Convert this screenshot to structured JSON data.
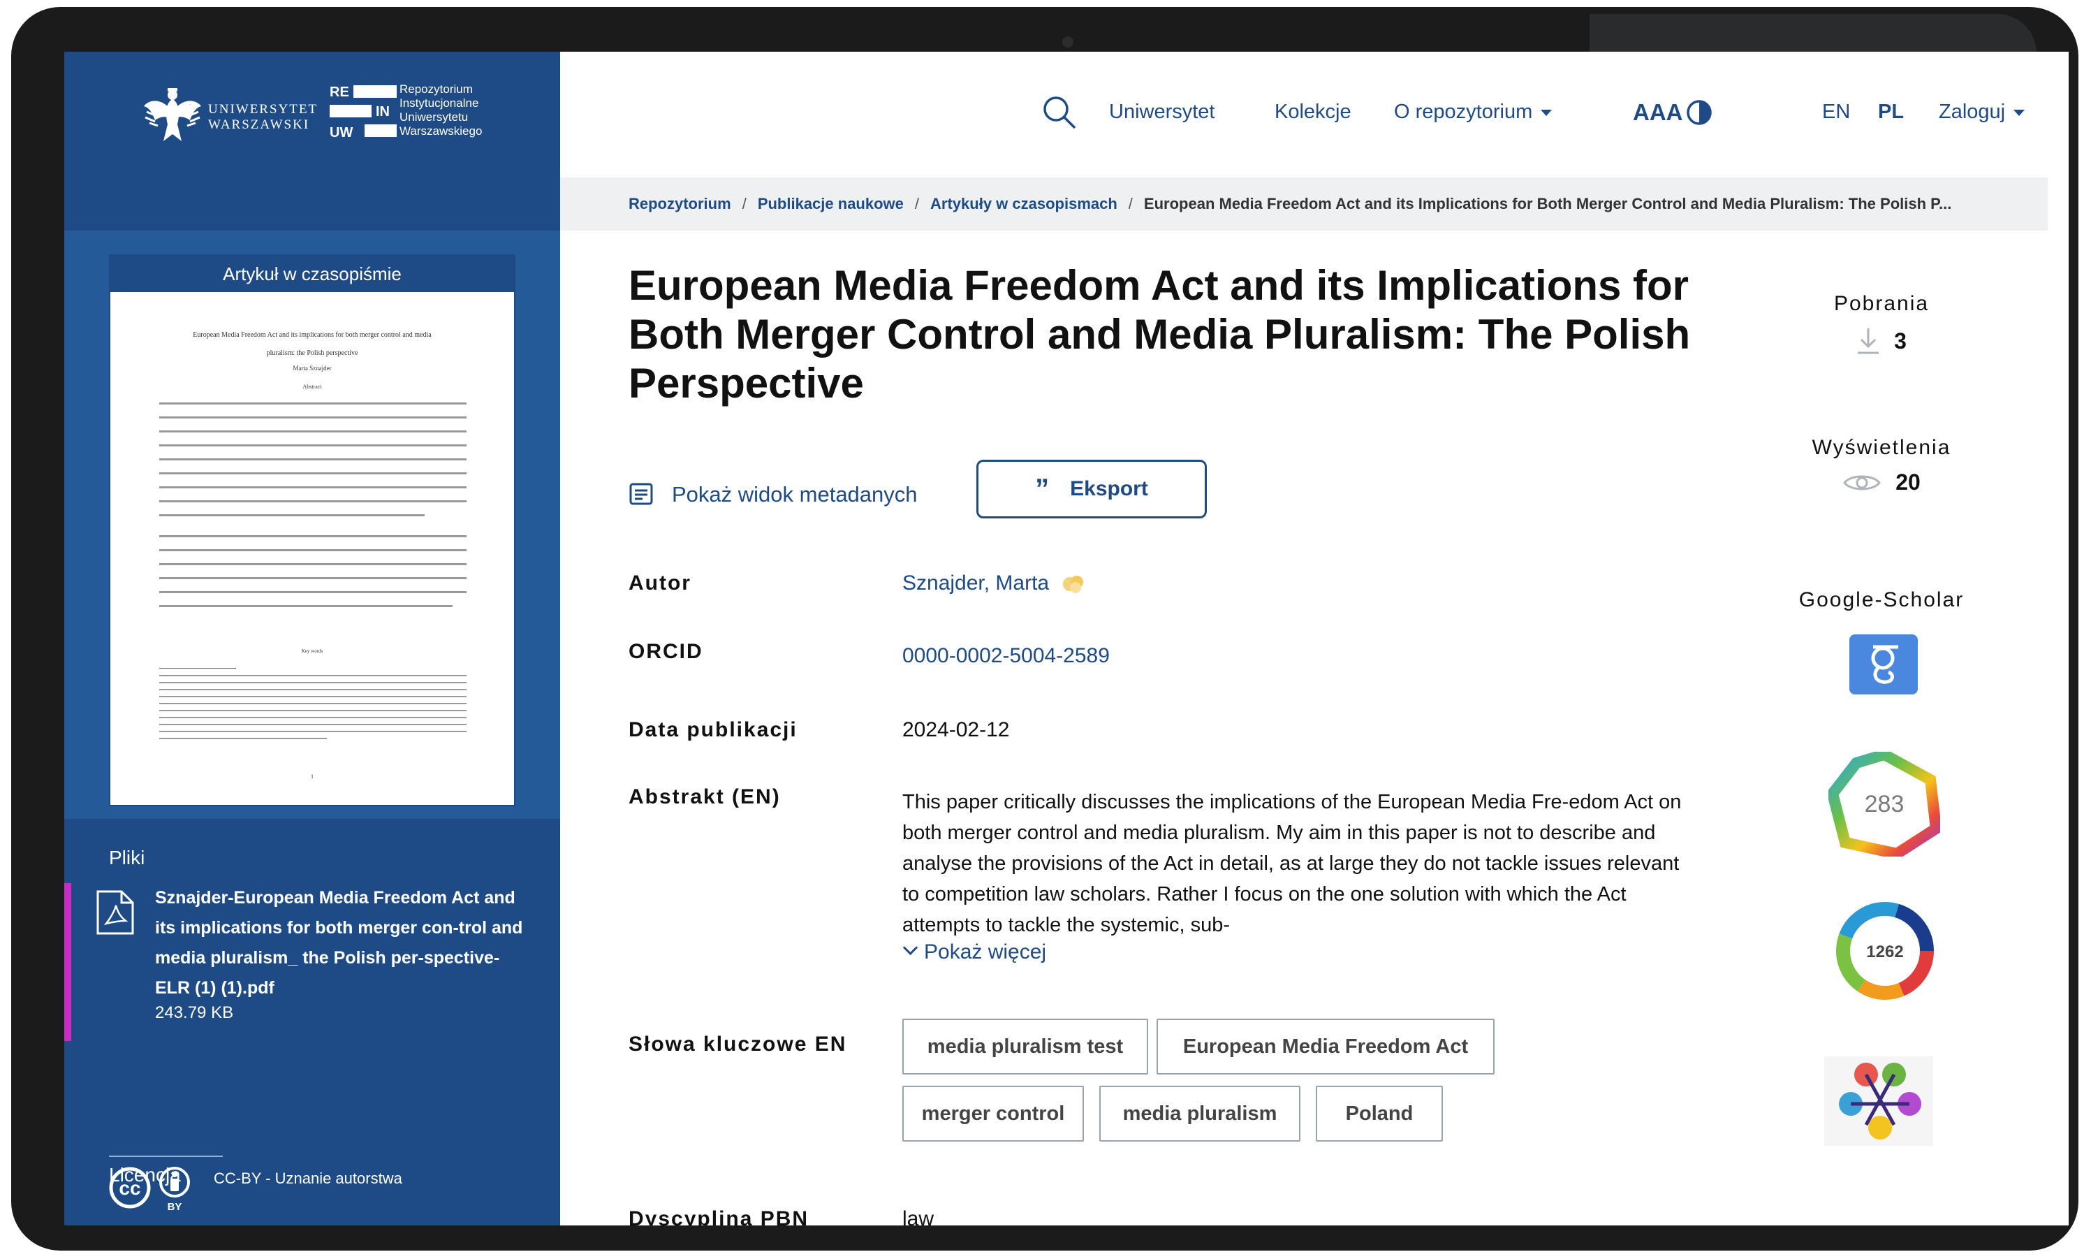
{
  "sidebar": {
    "university_name_line1": "UNIWERSYTET",
    "university_name_line2": "WARSZAWSKI",
    "repo_logo_lines": [
      "Repozytorium",
      "Instytucjonalne",
      "Uniwersytetu",
      "Warszawskiego"
    ],
    "repo_mark_letters": [
      "RE",
      "IN",
      "UW"
    ],
    "doc_type": "Artykuł w czasopiśmie",
    "files_label": "Pliki",
    "file": {
      "name": "Sznajder-European Media Freedom Act and its implications for both merger con-trol and media pluralism_ the Polish per-spective-ELR (1) (1).pdf",
      "size": "243.79 KB"
    },
    "license_label": "Licencja",
    "license_text": "CC-BY - Uznanie autorstwa",
    "license_badge_sub": "BY",
    "license_badge_cc": "cc"
  },
  "nav": {
    "items": [
      "Uniwersytet",
      "Kolekcje",
      "O repozytorium"
    ],
    "font_size_label": "AAA",
    "lang_en": "EN",
    "lang_pl": "PL",
    "login": "Zaloguj"
  },
  "breadcrumb": {
    "items": [
      "Repozytorium",
      "Publikacje naukowe",
      "Artykuły w czasopismach"
    ],
    "current": "European Media Freedom Act and its Implications for Both Merger Control and Media Pluralism: The Polish P..."
  },
  "item": {
    "title": "European Media Freedom Act and its Implications for Both Merger Control and Media Pluralism: The Polish Perspective",
    "show_metadata": "Pokaż widok metadanych",
    "export_label": "Eksport",
    "export_quote": "99",
    "fields": {
      "author_label": "Autor",
      "author_value": "Sznajder, Marta",
      "orcid_label": "ORCID",
      "orcid_value": "0000-0002-5004-2589",
      "date_label": "Data publikacji",
      "date_value": "2024-02-12",
      "abstract_label": "Abstrakt (EN)",
      "abstract_value": "This paper critically discusses the implications of the European Media Fre-edom Act on both merger control and media pluralism. My aim in this paper is not to describe and analyse the provisions of the Act in detail, as at large they do not tackle issues relevant to competition law scholars. Rather I focus on the one solution with which the Act attempts to tackle the systemic, sub-",
      "show_more": "Pokaż więcej",
      "keywords_label": "Słowa kluczowe EN",
      "keywords": [
        "media pluralism test",
        "European Media Freedom Act",
        "merger control",
        "media pluralism",
        "Poland"
      ],
      "discipline_label": "Dyscyplina PBN",
      "discipline_value": "law"
    }
  },
  "stats": {
    "downloads_label": "Pobrania",
    "downloads_value": "3",
    "views_label": "Wyświetlenia",
    "views_value": "20",
    "scholar_label": "Google-Scholar",
    "dimensions_value": "283",
    "altmetric_value": "1262"
  },
  "thumbnail": {
    "title_line1": "European Media Freedom Act and its implications for both merger control and media",
    "title_line2": "pluralism: the Polish perspective",
    "author": "Marta Sznajder",
    "abstract_heading": "Abstract",
    "keywords_heading": "Key words",
    "page_number": "1"
  },
  "colors": {
    "brand_navy": "#1e4b85",
    "sidebar_mid": "#255a98",
    "file_accent": "#c62ec1",
    "link": "#1e4b85"
  }
}
